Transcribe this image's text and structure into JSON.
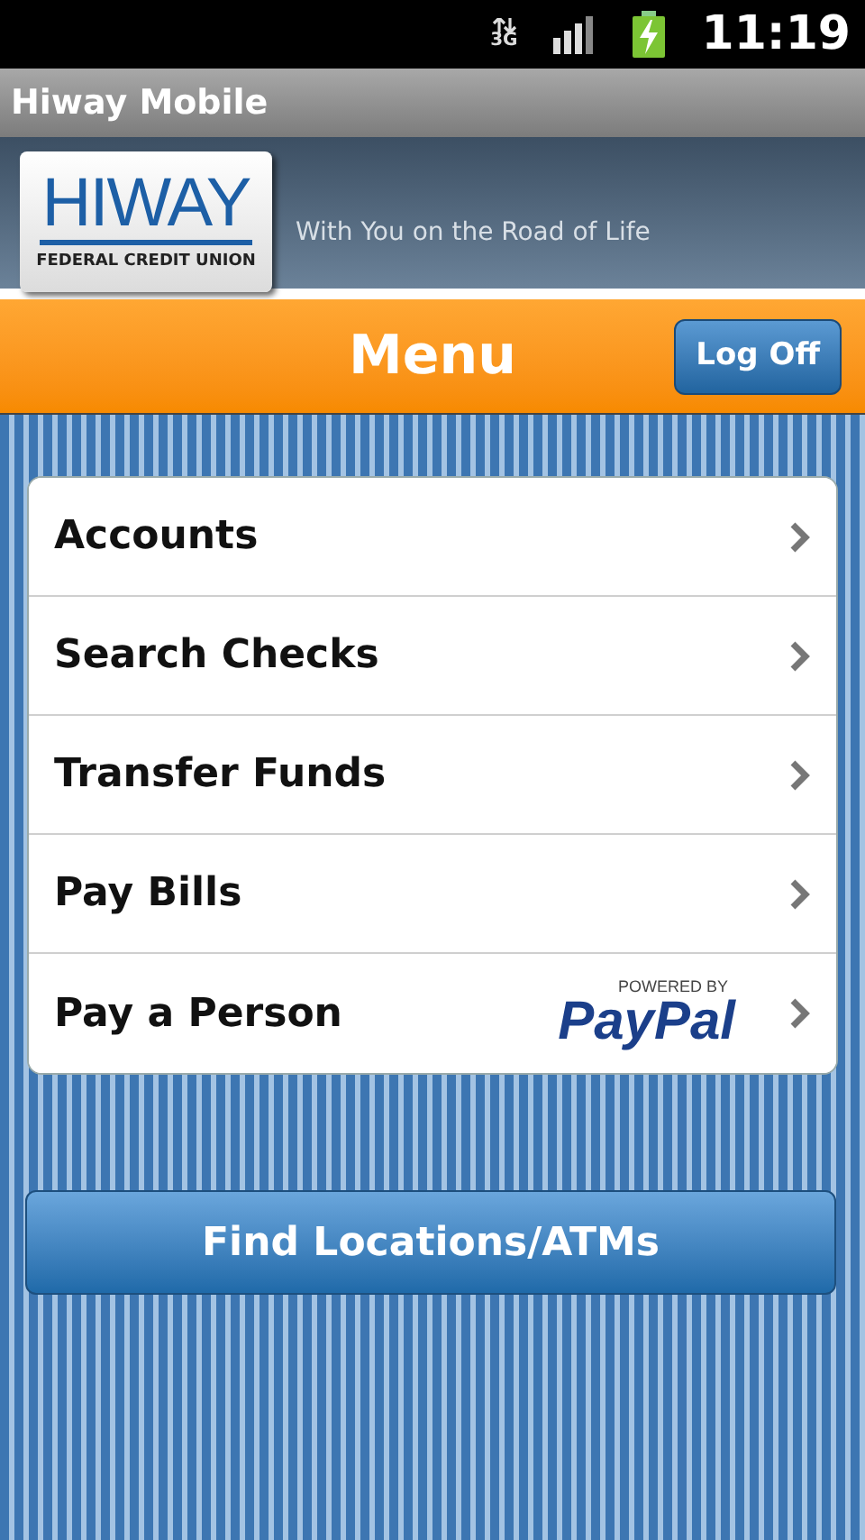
{
  "status_bar": {
    "network": "3G",
    "time": "11:19"
  },
  "window": {
    "title": "Hiway Mobile"
  },
  "banner": {
    "logo_name": "HIWAY",
    "logo_subtitle": "FEDERAL CREDIT UNION",
    "tagline": "With You on the Road of Life"
  },
  "header": {
    "title": "Menu",
    "button": "Log Off"
  },
  "menu": [
    {
      "kind": "plain",
      "label": "Accounts"
    },
    {
      "kind": "plain",
      "label": "Search Checks"
    },
    {
      "kind": "plain",
      "label": "Transfer Funds"
    },
    {
      "kind": "plain",
      "label": "Pay Bills"
    },
    {
      "kind": "paypal",
      "label": "Pay a Person",
      "badge_caption": "POWERED BY",
      "badge_name": "PayPal"
    }
  ],
  "footer_button": "Find Locations/ATMs"
}
